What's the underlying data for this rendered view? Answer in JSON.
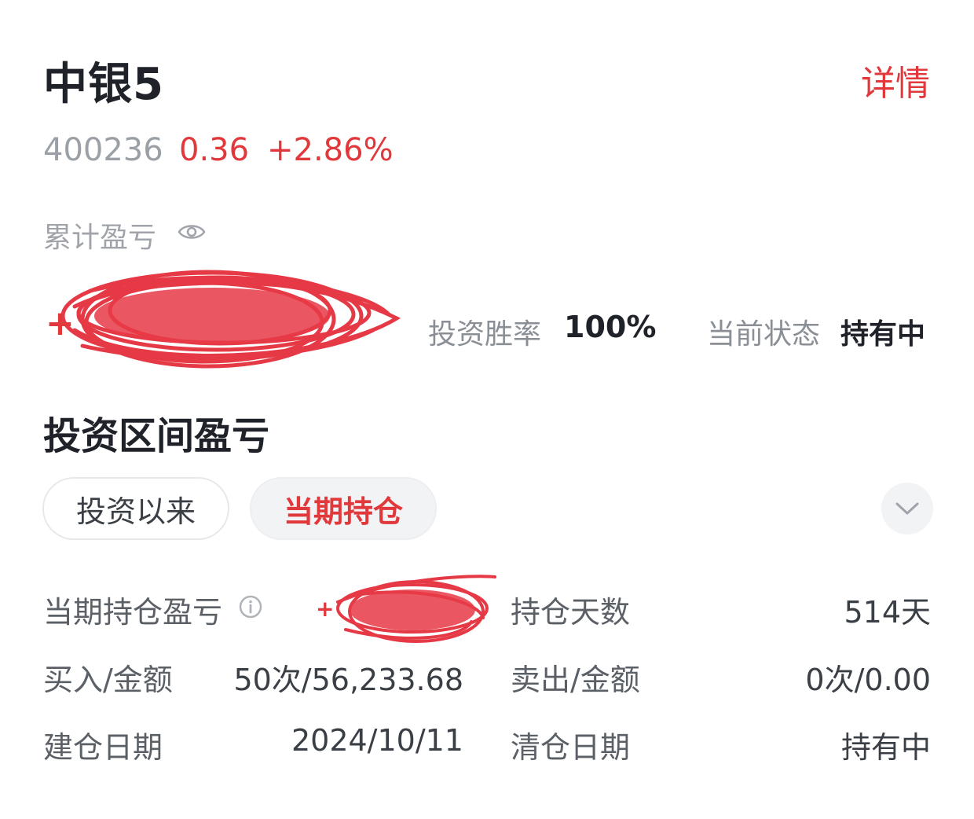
{
  "header": {
    "title": "中银5",
    "details_link": "详情"
  },
  "quote": {
    "code": "400236",
    "price": "0.36",
    "change_pct": "+2.86%"
  },
  "summary": {
    "cumulative_label": "累计盈亏",
    "cumulative_value_sign": "+",
    "win_rate_label": "投资胜率",
    "win_rate_value": "100%",
    "status_label": "当前状态",
    "status_value": "持有中"
  },
  "interval": {
    "title": "投资区间盈亏",
    "tabs": [
      {
        "label": "投资以来",
        "selected": false
      },
      {
        "label": "当期持仓",
        "selected": true
      }
    ]
  },
  "details": {
    "holding_pnl_label": "当期持仓盈亏",
    "holding_pnl_sign": "+",
    "holding_days_label": "持仓天数",
    "holding_days_value": "514天",
    "buy_label": "买入/金额",
    "buy_value": "50次/56,233.68",
    "sell_label": "卖出/金额",
    "sell_value": "0次/0.00",
    "open_date_label": "建仓日期",
    "open_date_value": "2024/10/11",
    "close_date_label": "清仓日期",
    "close_date_value": "持有中"
  },
  "colors": {
    "accent_red": "#e0383b",
    "text_dark": "#1f2329",
    "text_gray": "#8a8f96"
  },
  "icons": [
    "eye-icon",
    "info-icon",
    "chevron-down-icon"
  ]
}
